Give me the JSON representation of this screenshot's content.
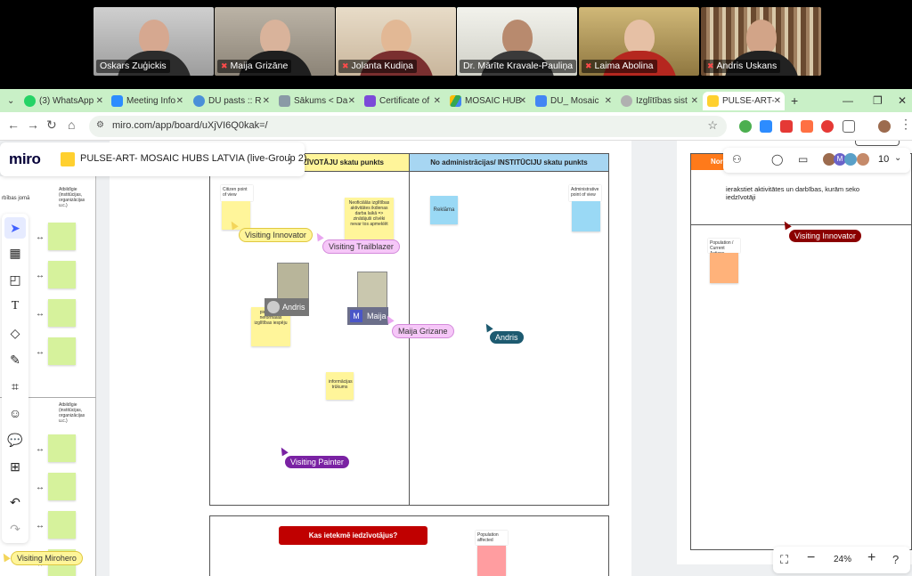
{
  "participants": [
    {
      "name": "Oskars Zuģickis",
      "muted": false
    },
    {
      "name": "Maija Grizāne",
      "muted": true
    },
    {
      "name": "Jolanta Kudiņa",
      "muted": true
    },
    {
      "name": "Dr. Mārīte Kravale-Pauliņa",
      "muted": false
    },
    {
      "name": "Laima Abolina",
      "muted": true
    },
    {
      "name": "Andris Uskans",
      "muted": true
    }
  ],
  "tabs": [
    {
      "label": "(3) WhatsApp"
    },
    {
      "label": "Meeting Info"
    },
    {
      "label": "DU pasts :: R"
    },
    {
      "label": "Sākums < Da"
    },
    {
      "label": "Certificate of"
    },
    {
      "label": "MOSAIC HUB"
    },
    {
      "label": "DU_ Mosaic"
    },
    {
      "label": "Izglītības sist"
    },
    {
      "label": "PULSE-ART-"
    }
  ],
  "address": {
    "url": "miro.com/app/board/uXjVI6Q0kak=/"
  },
  "miro": {
    "logo": "miro",
    "board_title": "PULSE-ART- MOSAIC HUBS LATVIA (live-Group 2)",
    "member_count": "10",
    "zoom": "24%"
  },
  "board": {
    "col1_header": "IEDZĪVOTĀJU skatu punkts",
    "col2_header": "No administrācijas/ INSTITŪCIJU skatu punkts",
    "citizen_pov": "Citizen point of view",
    "admin_pov": "Administrative point of view",
    "sticky_neform": "Neoficiālās izglītības aktivitātes ikdienas darba laikā => zinātājuši cilvēki nevar tos apmeklēt",
    "sticky_reklama": "Reklāma",
    "sticky_pieejam": "pieejamība neformālās izglītības iespēju",
    "sticky_info": "informācijas trūkums",
    "question_box": "Kas ietekmē iedzīvotājus?",
    "population_affected": "Population affected",
    "right_text": "ierakstiet aktivitātes un darbības, kurām seko iedzīvotāji",
    "population_current": "Population / Current Actions",
    "right_header": "Nor",
    "left_text_1": "Atbildīgie (institūcijas, organizācijas u.c.)",
    "left_text_2": "Atbildīgie (institūcijas, organizācijas u.c.)",
    "left_partial_1": "rbības jomā",
    "left_partial_2": "mo"
  },
  "cursors": {
    "innovator": "Visiting Innovator",
    "trailblazer": "Visiting Trailblazer",
    "andris_tag": "Andris",
    "maija_tag": "Maija",
    "maija_grizane": "Maija Grizane",
    "andris_cursor": "Andris",
    "painter": "Visiting Painter",
    "innovator_right": "Visiting Innovator",
    "mirohero": "Visiting Mirohero"
  },
  "colors": {
    "tabbar": "#c9f0c7",
    "miro_blue": "#4262ff",
    "accent_red": "#c00000"
  }
}
